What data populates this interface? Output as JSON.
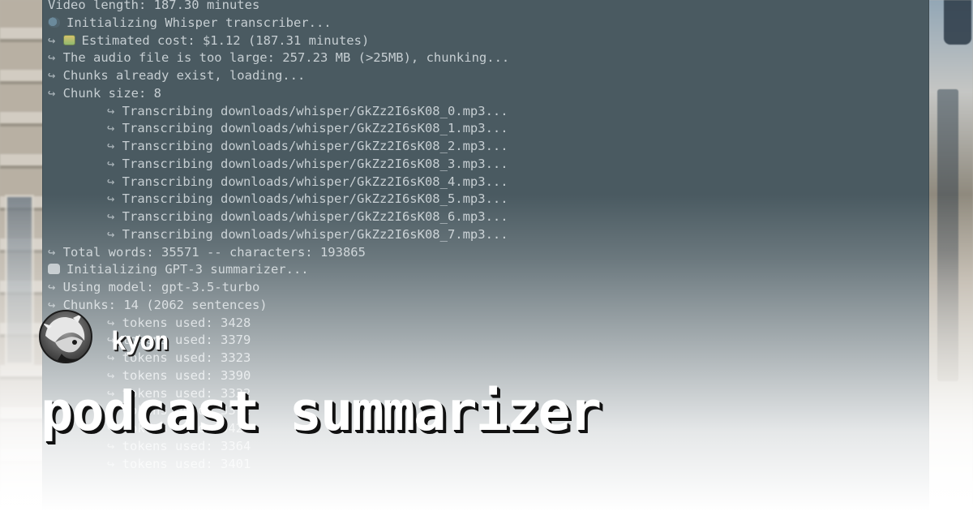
{
  "terminal": {
    "lines": [
      {
        "kind": "plain",
        "text": "Video length: 187.30 minutes"
      },
      {
        "kind": "icon",
        "icon": "speech-bubble-icon",
        "text": "Initializing Whisper transcriber..."
      },
      {
        "kind": "arrow-icon",
        "icon": "money-icon",
        "text": "Estimated cost: $1.12 (187.31 minutes)"
      },
      {
        "kind": "arrow",
        "text": "The audio file is too large: 257.23 MB (>25MB), chunking..."
      },
      {
        "kind": "arrow",
        "text": "Chunks already exist, loading..."
      },
      {
        "kind": "arrow",
        "text": "Chunk size: 8"
      },
      {
        "kind": "sub",
        "text": "Transcribing downloads/whisper/GkZz2I6sK08_0.mp3..."
      },
      {
        "kind": "sub",
        "text": "Transcribing downloads/whisper/GkZz2I6sK08_1.mp3..."
      },
      {
        "kind": "sub",
        "text": "Transcribing downloads/whisper/GkZz2I6sK08_2.mp3..."
      },
      {
        "kind": "sub",
        "text": "Transcribing downloads/whisper/GkZz2I6sK08_3.mp3..."
      },
      {
        "kind": "sub",
        "text": "Transcribing downloads/whisper/GkZz2I6sK08_4.mp3..."
      },
      {
        "kind": "sub",
        "text": "Transcribing downloads/whisper/GkZz2I6sK08_5.mp3..."
      },
      {
        "kind": "sub",
        "text": "Transcribing downloads/whisper/GkZz2I6sK08_6.mp3..."
      },
      {
        "kind": "sub",
        "text": "Transcribing downloads/whisper/GkZz2I6sK08_7.mp3..."
      },
      {
        "kind": "arrow",
        "text": "Total words: 35571 -- characters: 193865"
      },
      {
        "kind": "icon",
        "icon": "robot-icon",
        "text": "Initializing GPT-3 summarizer..."
      },
      {
        "kind": "arrow",
        "text": "Using model: gpt-3.5-turbo"
      },
      {
        "kind": "arrow",
        "text": "Chunks: 14 (2062 sentences)"
      },
      {
        "kind": "sub",
        "text": "tokens used: 3428"
      },
      {
        "kind": "sub",
        "text": "tokens used: 3379"
      },
      {
        "kind": "sub",
        "text": "tokens used: 3323"
      },
      {
        "kind": "sub",
        "text": "tokens used: 3390"
      },
      {
        "kind": "sub",
        "text": "tokens used: 3332"
      },
      {
        "kind": "sub",
        "text": "tokens used: 3372"
      },
      {
        "kind": "sub",
        "text": "tokens used: 3420"
      },
      {
        "kind": "sub",
        "text": "tokens used: 3364"
      },
      {
        "kind": "sub",
        "text": "tokens used: 3401"
      }
    ]
  },
  "author": {
    "name": "kyon",
    "avatar_icon": "avatar-icon"
  },
  "title": "podcast summarizer",
  "colors": {
    "terminal_bg": "#4a5a61",
    "terminal_text": "#c6ced2",
    "title_text": "#ffffff",
    "title_shadow": "#111111"
  }
}
